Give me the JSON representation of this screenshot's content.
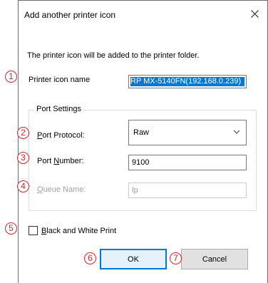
{
  "dialog": {
    "title": "Add another printer icon",
    "description": "The printer icon will be added to the printer folder."
  },
  "printer_name": {
    "label": "Printer icon name",
    "value": "RP MX-5140FN(192.168.0.239)"
  },
  "port_settings": {
    "group_label": "Port Settings",
    "protocol_label_mnemonic": "P",
    "protocol_label_rest": "ort Protocol:",
    "protocol_value": "Raw",
    "port_number_label_prefix": "Port ",
    "port_number_label_mnemonic": "N",
    "port_number_label_rest": "umber:",
    "port_number_value": "9100",
    "queue_label_mnemonic": "Q",
    "queue_label_rest": "ueue Name:",
    "queue_value": "lp"
  },
  "bw_print": {
    "mnemonic": "B",
    "rest": "lack and White Print",
    "checked": false
  },
  "buttons": {
    "ok": "OK",
    "cancel": "Cancel"
  },
  "callouts": [
    "1",
    "2",
    "3",
    "4",
    "5",
    "6",
    "7"
  ],
  "colors": {
    "accent": "#0078d7",
    "callout": "#d9232a"
  },
  "icons": {
    "close": "close-icon",
    "dropdown": "chevron-down-icon"
  }
}
